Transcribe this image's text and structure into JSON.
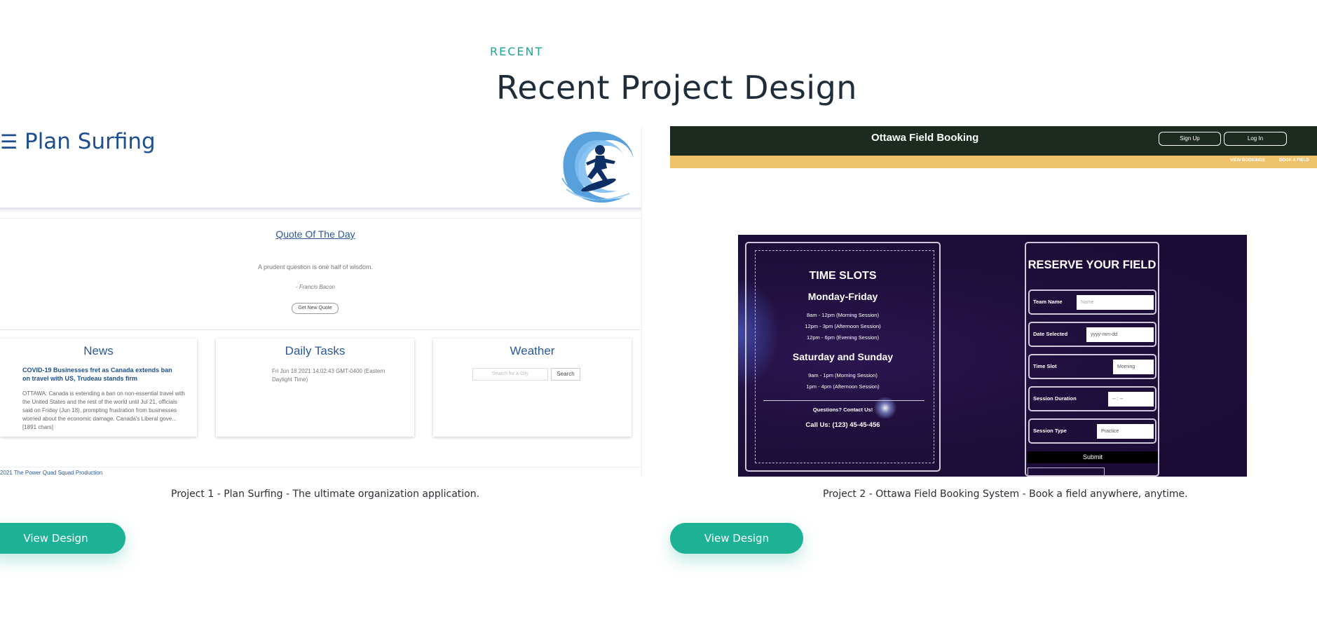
{
  "section": {
    "eyebrow": "RECENT",
    "heading": "Recent Project Design"
  },
  "colors": {
    "accent": "#1db195",
    "eyebrow": "#1ba696",
    "heading": "#1f2d3a"
  },
  "projects": [
    {
      "caption": "Project 1 - Plan Surfing - The ultimate organization application.",
      "button_label": "View Design",
      "screenshot": {
        "menu_icon": "hamburger-menu-icon",
        "title": "Plan Surfing",
        "logo": "surfer-wave-logo",
        "quote_title": "Quote Of The Day",
        "quote": "A prudent question is one half of wisdom.",
        "author": "- Francis Bacon",
        "quote_button": "Get New Quote",
        "news": {
          "title": "News",
          "headline": "COVID-19 Businesses fret as Canada extends ban on travel with US, Trudeau stands firm",
          "body": "OTTAWA: Canada is extending a ban on non-essential travel with the United States and the rest of the world until Jul 21, officials said on Friday (Jun 18), prompting frustration from businesses worried about the economic damage. Canada's Liberal gove... [1891 chars]"
        },
        "tasks": {
          "title": "Daily Tasks",
          "date": "Fri Jun 18 2021 14:02:43 GMT-0400 (Eastern Daylight Time)"
        },
        "weather": {
          "title": "Weather",
          "search_placeholder": "Search for a City",
          "search_button": "Search"
        },
        "footer": "2021 The Power Quad Squad Production"
      }
    },
    {
      "caption": "Project 2 - Ottawa Field Booking System - Book a field anywhere, anytime.",
      "button_label": "View Design",
      "screenshot": {
        "title": "Ottawa Field Booking",
        "signup": "Sign Up",
        "login": "Log In",
        "nav": [
          "VIEW BOOKINGS",
          "BOOK A FIELD"
        ],
        "slots_title": "TIME SLOTS",
        "weekdays": "Monday-Friday",
        "weekday_slots": [
          "8am - 12pm (Morning Session)",
          "12pm - 3pm (Afternoon Session)",
          "12pm - 6pm (Evening Session)"
        ],
        "weekend": "Saturday and Sunday",
        "weekend_slots": [
          "9am - 1pm (Morning Session)",
          "1pm - 4pm (Afternoon Session)"
        ],
        "questions": "Questions? Contact Us!",
        "phone": "Call Us: (123) 45-45-456",
        "form_title": "RESERVE YOUR FIELD",
        "fields": [
          {
            "label": "Team Name",
            "value": "Name"
          },
          {
            "label": "Date Selected",
            "value": "yyyy-mm-dd"
          },
          {
            "label": "Time Slot",
            "value": "Morning"
          },
          {
            "label": "Session Duration",
            "value": "-- : --"
          },
          {
            "label": "Session Type",
            "value": "Practice"
          }
        ],
        "submit": "Submit"
      }
    }
  ]
}
